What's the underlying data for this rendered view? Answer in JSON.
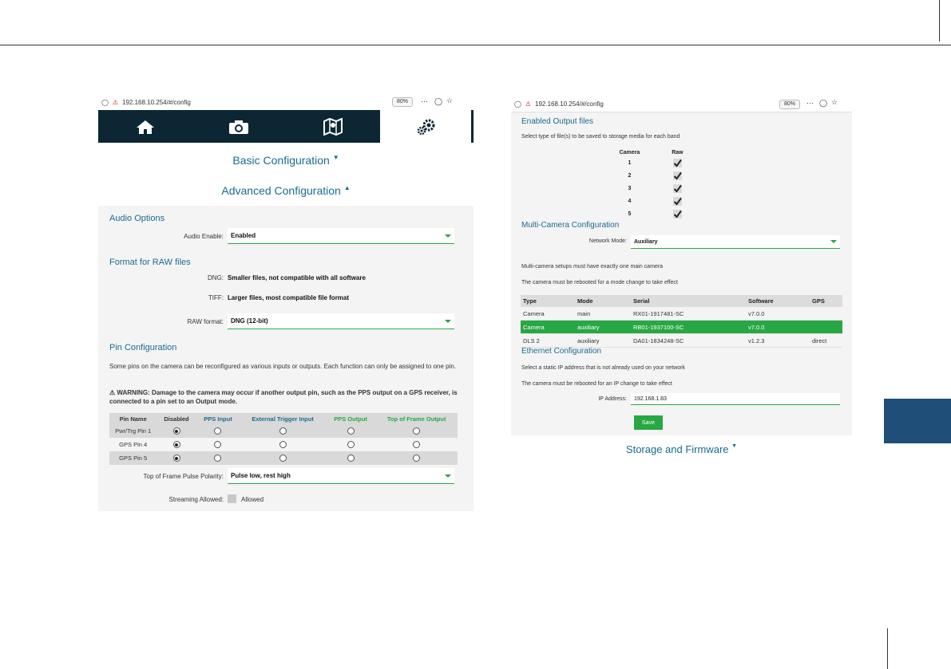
{
  "left": {
    "url": "192.168.10.254/#/config",
    "zoom": "80%",
    "nav": [
      "home-icon",
      "camera-icon",
      "map-icon",
      "settings-icon"
    ],
    "basic_title": "Basic Configuration",
    "advanced_title": "Advanced Configuration",
    "audio": {
      "title": "Audio Options",
      "enable_label": "Audio Enable:",
      "enable_value": "Enabled"
    },
    "raw": {
      "title": "Format for RAW files",
      "dng_label": "DNG:",
      "dng_desc": "Smaller files, not compatible with all software",
      "tiff_label": "TIFF:",
      "tiff_desc": "Larger files, most compatible file format",
      "format_label": "RAW format:",
      "format_value": "DNG (12-bit)"
    },
    "pins": {
      "title": "Pin Configuration",
      "desc": "Some pins on the camera can be reconfigured as various inputs or outputs. Each function can only be assigned to one pin.",
      "warning": "⚠ WARNING: Damage to the camera may occur if another output pin, such as the PPS output on a GPS receiver, is connected to a pin set to an Output mode.",
      "headers": [
        "Pin Name",
        "Disabled",
        "PPS Input",
        "External Trigger Input",
        "PPS Output",
        "Top of Frame Output"
      ],
      "header_colors": [
        "#333333",
        "#333333",
        "#1a6b8f",
        "#1a6b8f",
        "#28a745",
        "#28a745"
      ],
      "rows": [
        {
          "name": "Pwr/Trg Pin 1",
          "selected": 0
        },
        {
          "name": "GPS Pin 4",
          "selected": 0
        },
        {
          "name": "GPS Pin 5",
          "selected": 0
        }
      ],
      "polarity_label": "Top of Frame Pulse Polarity:",
      "polarity_value": "Pulse low, rest high",
      "streaming_label": "Streaming Allowed:",
      "streaming_value": "Allowed"
    }
  },
  "right": {
    "url": "192.168.10.254/#/config",
    "zoom": "80%",
    "output": {
      "title": "Enabled Output files",
      "desc": "Select type of file(s) to be saved to storage media for each band",
      "col_camera": "Camera",
      "col_raw": "Raw",
      "cameras": [
        "1",
        "2",
        "3",
        "4",
        "5"
      ]
    },
    "multi": {
      "title": "Multi-Camera Configuration",
      "mode_label": "Network Mode:",
      "mode_value": "Auxiliary",
      "note1": "Multi-camera setups must have exactly one main camera",
      "note2": "The camera must be rebooted for a mode change to take effect",
      "headers": [
        "Type",
        "Mode",
        "Serial",
        "Software",
        "GPS"
      ],
      "rows": [
        [
          "Camera",
          "main",
          "RX01-1917481-SC",
          "v7.0.0",
          ""
        ],
        [
          "Camera",
          "auxiliary",
          "RB01-1937100-SC",
          "v7.0.0",
          ""
        ],
        [
          "DLS 2",
          "auxiliary",
          "DA01-1834248-SC",
          "v1.2.3",
          "direct"
        ]
      ]
    },
    "ethernet": {
      "title": "Ethernet Configuration",
      "note1": "Select a static IP address that is not already used on your network",
      "note2": "The camera must be rebooted for an IP change to take effect",
      "ip_label": "IP Address:",
      "ip_value": "192.168.1.83",
      "save_label": "Save"
    },
    "storage_title": "Storage and Firmware"
  }
}
